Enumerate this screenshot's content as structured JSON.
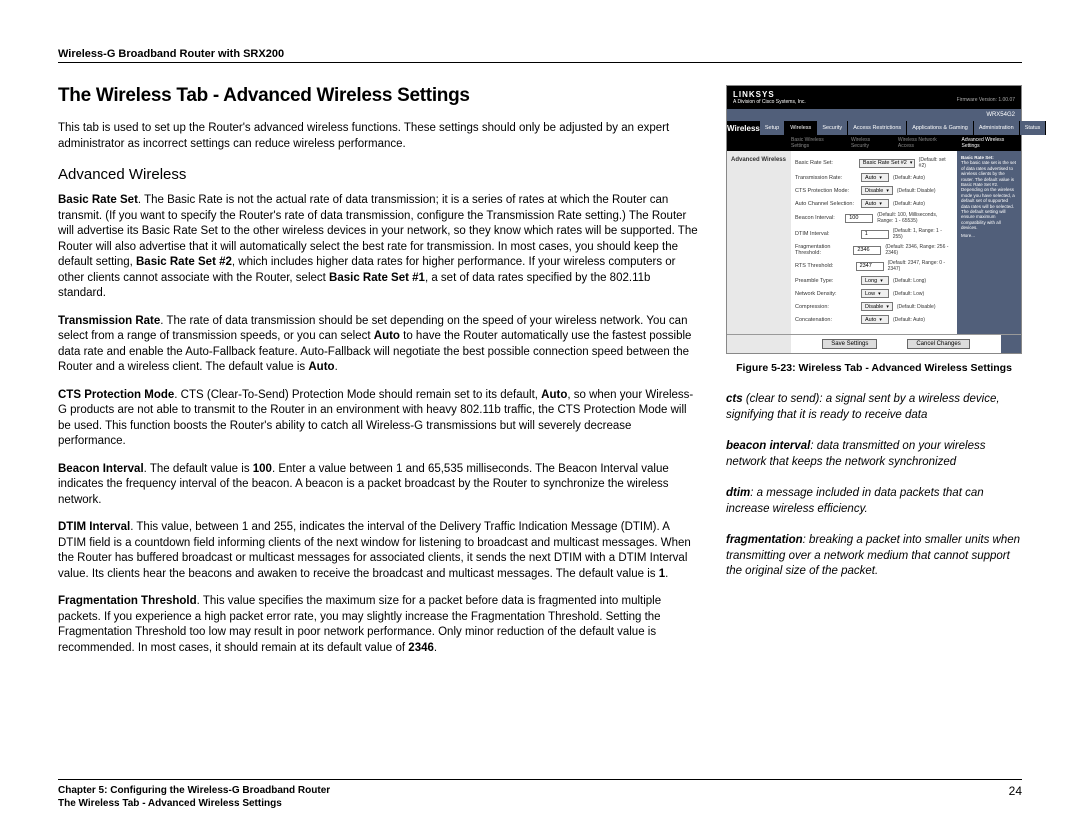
{
  "header": {
    "product": "Wireless-G Broadband Router with SRX200"
  },
  "title": "The Wireless Tab - Advanced Wireless Settings",
  "intro": "This tab is used to set up the Router's advanced wireless functions. These settings should only be adjusted by an expert administrator as incorrect settings can reduce wireless performance.",
  "section_heading": "Advanced Wireless",
  "paras": {
    "basic_rate": {
      "label": "Basic Rate Set",
      "text": ". The Basic Rate is not the actual rate of data transmission; it is a series of rates at which the Router can transmit. (If you want to specify the Router's rate of data transmission, configure the Transmission Rate setting.) The Router will advertise its Basic Rate Set to the other wireless devices in your network, so they know which rates will be supported. The Router will also advertise that it will automatically select the best rate for transmission. In most cases, you should keep the default setting, ",
      "bold2": "Basic Rate Set #2",
      "text2": ", which includes higher data rates for higher performance. If your wireless computers or other clients cannot associate with the Router, select ",
      "bold3": "Basic Rate Set #1",
      "text3": ", a set of data rates specified by the 802.11b standard."
    },
    "tx_rate": {
      "label": "Transmission Rate",
      "text": ". The rate of data transmission should be set depending on the speed of your wireless network. You can select from a range of transmission speeds, or you can select ",
      "bold2": "Auto",
      "text2": " to have the Router automatically use the fastest possible data rate and enable the Auto-Fallback feature. Auto-Fallback will negotiate the best possible connection speed between the Router and a wireless client. The default value is ",
      "bold3": "Auto",
      "text3": "."
    },
    "cts": {
      "label": "CTS Protection Mode",
      "text": ". CTS (Clear-To-Send) Protection Mode should remain set to its default, ",
      "bold2": "Auto",
      "text2": ", so when your Wireless-G products are not able to transmit to the Router in an environment with heavy 802.11b traffic, the CTS Protection Mode will be used. This function boosts the Router's ability to catch all Wireless-G transmissions but will severely decrease performance."
    },
    "beacon": {
      "label": "Beacon Interval",
      "text": ". The default value is ",
      "bold2": "100",
      "text2": ". Enter a value between 1 and 65,535 milliseconds. The Beacon Interval value indicates the frequency interval of the beacon. A beacon is a packet broadcast by the Router to synchronize the wireless network."
    },
    "dtim": {
      "label": "DTIM Interval",
      "text": ". This value, between 1 and 255, indicates the interval of the Delivery Traffic Indication Message (DTIM). A DTIM field is a countdown field informing clients of the next window for listening to broadcast and multicast messages. When the Router has buffered broadcast or multicast messages for associated clients, it sends the next DTIM with a DTIM Interval value. Its clients hear the beacons and awaken to receive the broadcast and multicast messages. The default value is ",
      "bold2": "1",
      "text2": "."
    },
    "frag": {
      "label": "Fragmentation Threshold",
      "text": ". This value specifies the maximum size for a packet before data is fragmented into multiple packets. If you experience a high packet error rate, you may slightly increase the Fragmentation Threshold. Setting the Fragmentation Threshold too low may result in poor network performance. Only minor reduction of the default value is recommended. In most cases, it should remain at its default value of ",
      "bold2": "2346",
      "text2": "."
    }
  },
  "screenshot": {
    "brand": "LINKSYS",
    "brand_sub": "A Division of Cisco Systems, Inc.",
    "firmware": "Firmware Version: 1.00.07",
    "model": "WRX54G2",
    "section": "Wireless",
    "tabs": [
      "Setup",
      "Wireless",
      "Security",
      "Access Restrictions",
      "Applications & Gaming",
      "Administration",
      "Status"
    ],
    "subtabs": [
      "Basic Wireless Settings",
      "Wireless Security",
      "Wireless Network Access",
      "Advanced Wireless Settings"
    ],
    "panel_label": "Advanced Wireless",
    "rows": [
      {
        "lbl": "Basic Rate Set:",
        "ctl": "sel",
        "val": "Basic Rate Set #2",
        "def": "(Default: set #2)"
      },
      {
        "lbl": "Transmission Rate:",
        "ctl": "sel",
        "val": "Auto",
        "def": "(Default: Auto)"
      },
      {
        "lbl": "CTS Protection Mode:",
        "ctl": "sel",
        "val": "Disable",
        "def": "(Default: Disable)"
      },
      {
        "lbl": "Auto Channel Selection:",
        "ctl": "sel",
        "val": "Auto",
        "def": "(Default: Auto)"
      },
      {
        "lbl": "Beacon Interval:",
        "ctl": "txt",
        "val": "100",
        "def": "(Default: 100, Milliseconds, Range: 1 - 65535)"
      },
      {
        "lbl": "DTIM Interval:",
        "ctl": "txt",
        "val": "1",
        "def": "(Default: 1, Range: 1 - 255)"
      },
      {
        "lbl": "Fragmentation Threshold:",
        "ctl": "txt",
        "val": "2346",
        "def": "(Default: 2346, Range: 256 - 2346)"
      },
      {
        "lbl": "RTS Threshold:",
        "ctl": "txt",
        "val": "2347",
        "def": "(Default: 2347, Range: 0 - 2347)"
      },
      {
        "lbl": "Preamble Type:",
        "ctl": "sel",
        "val": "Long",
        "def": "(Default: Long)"
      },
      {
        "lbl": "Network Density:",
        "ctl": "sel",
        "val": "Low",
        "def": "(Default: Low)"
      },
      {
        "lbl": "Compression:",
        "ctl": "sel",
        "val": "Disable",
        "def": "(Default: Disable)"
      },
      {
        "lbl": "Concatenation:",
        "ctl": "sel",
        "val": "Auto",
        "def": "(Default: Auto)"
      }
    ],
    "help_title": "Basic Rate Set:",
    "help_body": "The basic rate set is the set of data rates advertised to wireless clients by the router. The default value is Basic Rate Set #2. Depending on the wireless mode you have selected, a default set of supported data rates will be selected. The default setting will ensure maximum compatibility with all devices.",
    "help_more": "More...",
    "btn_save": "Save Settings",
    "btn_cancel": "Cancel Changes"
  },
  "figure_caption": "Figure 5-23: Wireless Tab - Advanced Wireless Settings",
  "glossary": [
    {
      "term": "cts",
      "def": " (clear to send): a signal sent by a wireless device, signifying that it is ready to receive data"
    },
    {
      "term": "beacon interval",
      "def": ": data transmitted on your wireless network that keeps the network synchronized"
    },
    {
      "term": "dtim",
      "def": ": a message included in data packets that can increase wireless efficiency."
    },
    {
      "term": "fragmentation",
      "def": ": breaking a packet into smaller units when transmitting over a network medium that cannot support the original size of the packet."
    }
  ],
  "footer": {
    "chapter": "Chapter 5: Configuring the Wireless-G Broadband Router",
    "subtitle": "The Wireless Tab - Advanced Wireless Settings",
    "page": "24"
  }
}
